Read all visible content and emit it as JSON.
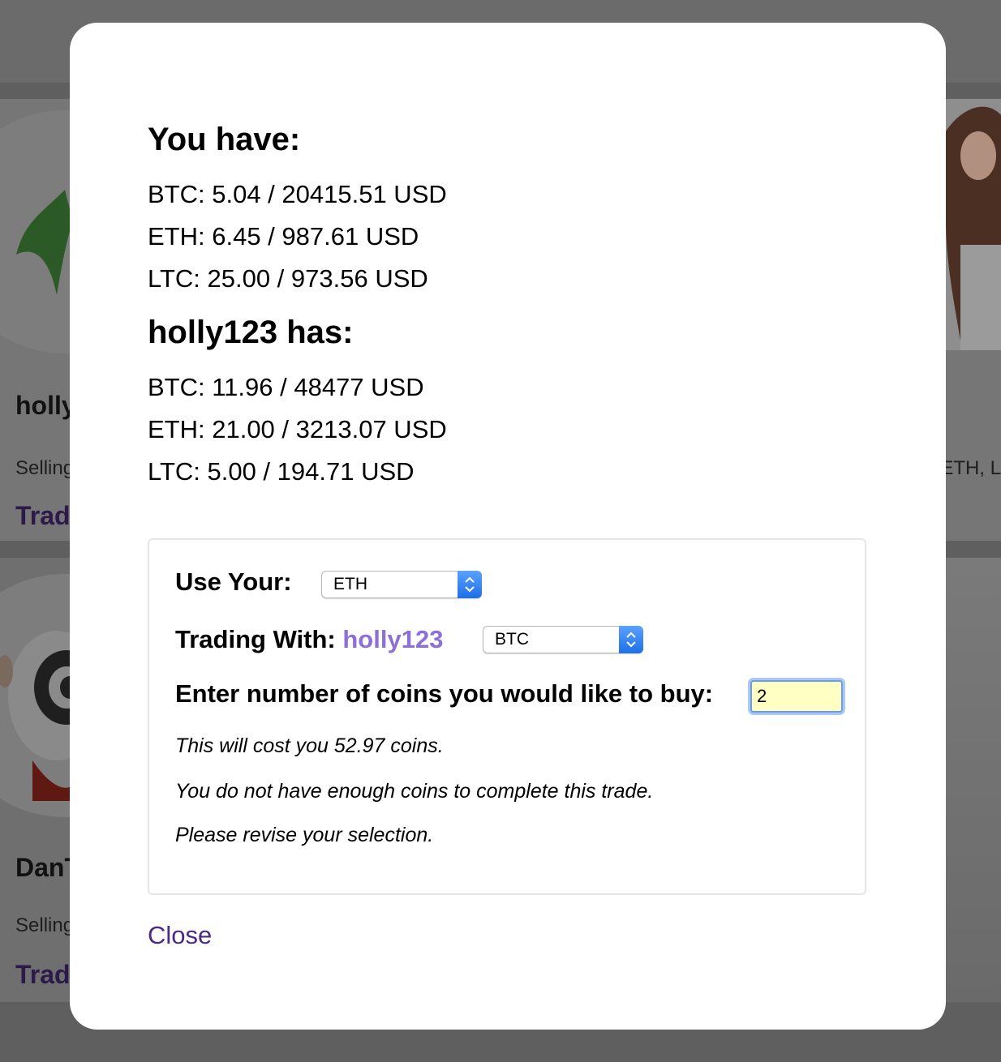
{
  "background": {
    "cards": [
      {
        "name": "holly",
        "selling": "Selling",
        "selling_right": "ETH, L",
        "trade": "Trad"
      },
      {
        "name": "DanT",
        "selling": "Selling",
        "trade": "Trad"
      }
    ]
  },
  "modal": {
    "you_heading": "You have:",
    "you_balances": [
      "BTC: 5.04 / 20415.51 USD",
      "ETH: 6.45 / 987.61 USD",
      "LTC: 25.00 / 973.56 USD"
    ],
    "peer_heading": "holly123 has:",
    "peer_balances": [
      "BTC: 11.96 / 48477 USD",
      "ETH: 21.00 / 3213.07 USD",
      "LTC: 5.00 / 194.71 USD"
    ],
    "trade": {
      "use_label": "Use Your:",
      "use_value": "ETH",
      "trading_label": "Trading With:",
      "trading_peer": "holly123",
      "trading_value": "BTC",
      "qty_label": "Enter number of coins you would like to buy:",
      "qty_value": "2",
      "cost_note": "This will cost you 52.97 coins.",
      "warning_note": "You do not have enough coins to complete this trade.",
      "revise_note": "Please revise your selection."
    },
    "close_label": "Close"
  },
  "colors": {
    "peer_accent": "#8c70d8",
    "close_link": "#4b2a86",
    "input_bg": "#ffffc4",
    "select_button": "#1f6fe6"
  }
}
